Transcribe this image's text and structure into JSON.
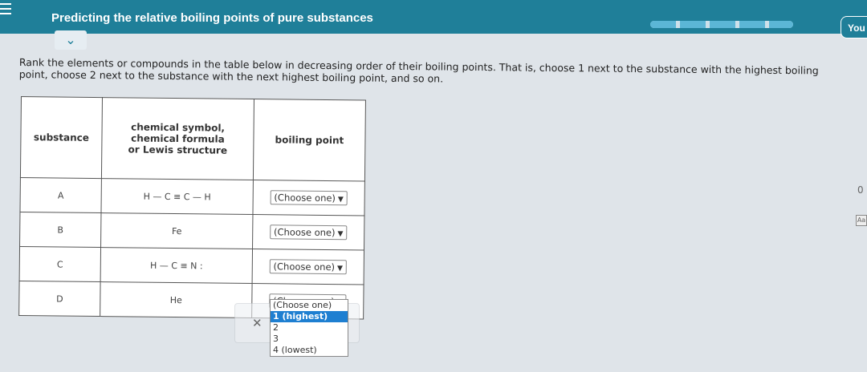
{
  "header": {
    "title": "Predicting the relative boiling points of pure substances",
    "user_button": "You"
  },
  "progress": {
    "segments_filled": 5,
    "segments_total": 5
  },
  "instructions": "Rank the elements or compounds in the table below in decreasing order of their boiling points. That is, choose 1 next to the substance with the highest boiling point, choose 2 next to the substance with the next highest boiling point, and so on.",
  "table": {
    "headers": {
      "substance": "substance",
      "symbol_line1": "chemical symbol,",
      "symbol_line2": "chemical formula",
      "symbol_line3": "or Lewis structure",
      "boiling_point": "boiling point"
    },
    "rows": [
      {
        "label": "A",
        "formula": "H — C ≡ C — H",
        "select": "(Choose one)"
      },
      {
        "label": "B",
        "formula": "Fe",
        "select": "(Choose one)"
      },
      {
        "label": "C",
        "formula": "H — C ≡ N :",
        "select": "(Choose one)"
      },
      {
        "label": "D",
        "formula": "He",
        "select": "(Choose one)"
      }
    ]
  },
  "dropdown": {
    "options": [
      "(Choose one)",
      "1 (highest)",
      "2",
      "3",
      "4 (lowest)"
    ],
    "selected_index": 1
  },
  "side": {
    "char_top": "0",
    "icon_label": "Aa"
  },
  "colors": {
    "header": "#1f7f99",
    "selected_option": "#1e7fd1",
    "progress": "#5bb6d6"
  }
}
